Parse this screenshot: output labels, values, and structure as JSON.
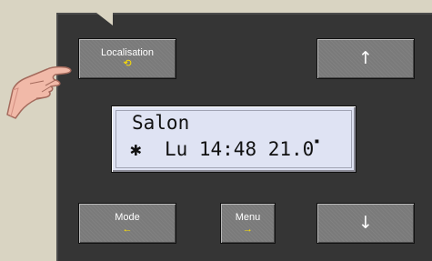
{
  "buttons": {
    "localisation": {
      "label": "Localisation",
      "symbol": "⟲"
    },
    "up": {
      "symbol": "↑"
    },
    "mode": {
      "label": "Mode",
      "symbol": "←"
    },
    "menu": {
      "label": "Menu",
      "symbol": "→"
    },
    "down": {
      "symbol": "↓"
    }
  },
  "display": {
    "line1": "Salon",
    "icon": "✱",
    "line2": "Lu 14:48 21.0"
  },
  "icons": {
    "hand": "pointing-hand-icon"
  },
  "colors": {
    "background": "#d9d4c2",
    "panel": "#353535",
    "button": "#7a7a7a",
    "accent": "#ffe100",
    "lcd": "#dfe3f3"
  }
}
